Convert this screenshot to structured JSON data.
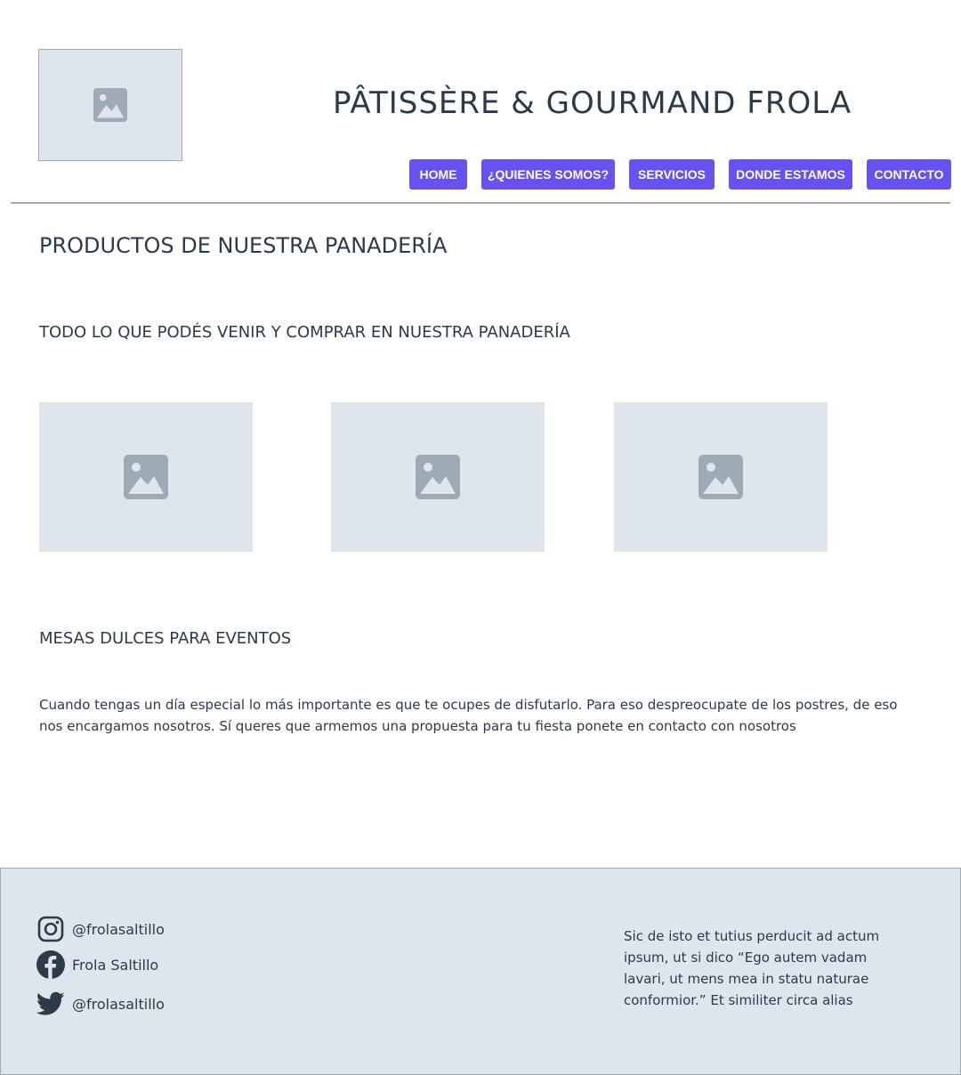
{
  "header": {
    "title": "PÂTISSÈRE & GOURMAND  FROLA",
    "logo_icon": "image-placeholder-icon"
  },
  "nav": {
    "items": [
      {
        "label": "HOME"
      },
      {
        "label": "¿QUIENES SOMOS?"
      },
      {
        "label": "SERVICIOS"
      },
      {
        "label": "DONDE ESTAMOS"
      },
      {
        "label": "CONTACTO"
      }
    ]
  },
  "main": {
    "products_title": "PRODUCTOS DE NUESTRA PANADERÍA",
    "products_subtitle": "TODO LO QUE PODÉS VENIR Y COMPRAR EN NUESTRA PANADERÍA",
    "mesas_title": "MESAS DULCES PARA EVENTOS",
    "mesas_text": "Cuando tengas un día especial lo más importante es que te ocupes de disfutarlo. Para eso despreocupate de los postres, de eso nos encargamos nosotros. Sí queres que armemos una propuesta para tu fiesta ponete en contacto con nosotros"
  },
  "footer": {
    "social": [
      {
        "icon": "instagram-icon",
        "label": "@frolasaltillo"
      },
      {
        "icon": "facebook-icon",
        "label": "Frola Saltillo"
      },
      {
        "icon": "twitter-icon",
        "label": "@frolasaltillo"
      }
    ],
    "text": "Sic de isto et tutius perducit ad actum ipsum, ut si dico “Ego autem vadam lavari, ut mens mea in statu naturae conformior.” Et similiter circa alias"
  },
  "colors": {
    "accent": "#6652f0",
    "placeholder_bg": "#dfe5ed",
    "placeholder_icon": "#9eaab6",
    "text": "#2d3a48",
    "border": "#a0adb9"
  }
}
